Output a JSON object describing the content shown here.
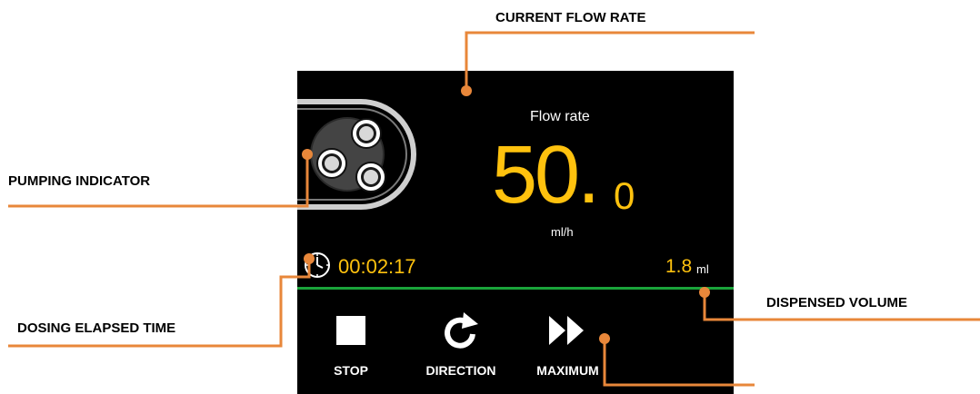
{
  "callouts": {
    "current_flow_rate": "CURRENT FLOW RATE",
    "pumping_indicator": "PUMPING INDICATOR",
    "dosing_elapsed_time": "DOSING ELAPSED TIME",
    "dispensed_volume": "DISPENSED VOLUME"
  },
  "screen": {
    "flow": {
      "title": "Flow rate",
      "value_integer": "50.",
      "value_decimal": "0",
      "unit": "ml/h"
    },
    "elapsed_time": "00:02:17",
    "volume": {
      "value": "1.8",
      "unit": "ml"
    },
    "buttons": {
      "stop": "STOP",
      "direction": "DIRECTION",
      "maximum": "MAXIMUM"
    },
    "icons": {
      "pump": "peristaltic-pump-icon",
      "clock": "clock-icon",
      "stop": "stop-square-icon",
      "direction": "rotate-arrow-icon",
      "maximum": "fast-forward-icon"
    }
  },
  "colors": {
    "callout_line": "#e8873a",
    "value_yellow": "#ffc20e",
    "divider_green": "#1aa33a",
    "screen_bg": "#000000"
  }
}
